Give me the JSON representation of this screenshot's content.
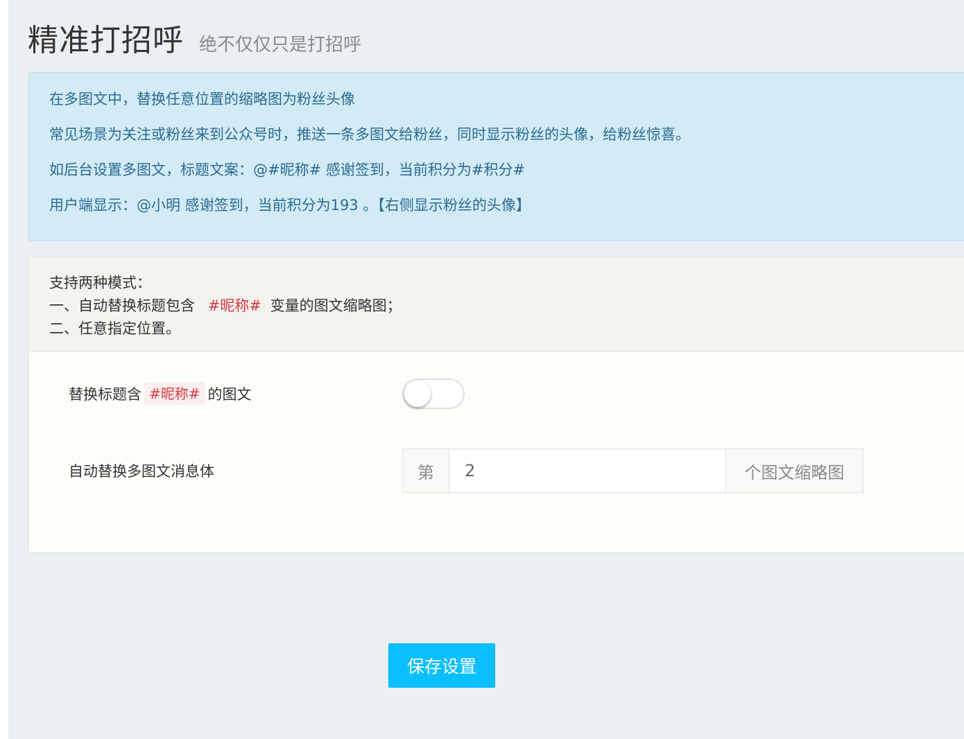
{
  "header": {
    "title": "精准打招呼",
    "subtitle": "绝不仅仅只是打招呼"
  },
  "info": {
    "lines": [
      "在多图文中，替换任意位置的缩略图为粉丝头像",
      "常见场景为关注或粉丝来到公众号时，推送一条多图文给粉丝，同时显示粉丝的头像，给粉丝惊喜。",
      "如后台设置多图文，标题文案：@#昵称# 感谢签到，当前积分为#积分#",
      "用户端显示：@小明 感谢签到，当前积分为193 。【右侧显示粉丝的头像】"
    ]
  },
  "panel": {
    "modes_title": "支持两种模式：",
    "mode1_prefix": "一、自动替换标题包含",
    "mode1_var": "#昵称#",
    "mode1_suffix": "变量的图文缩略图；",
    "mode2": "二、任意指定位置。"
  },
  "form": {
    "replace_label_prefix": "替换标题含",
    "replace_label_var": "#昵称#",
    "replace_label_suffix": "的图文",
    "replace_toggle_on": false,
    "auto_label": "自动替换多图文消息体",
    "prefix_addon": "第",
    "position_value": "2",
    "suffix_addon": "个图文缩略图"
  },
  "actions": {
    "save_label": "保存设置"
  },
  "colors": {
    "primary_button": "#0abfff",
    "info_bg": "#d2ebf7",
    "info_text": "#2c6b8f",
    "variable_red": "#d9383f"
  }
}
